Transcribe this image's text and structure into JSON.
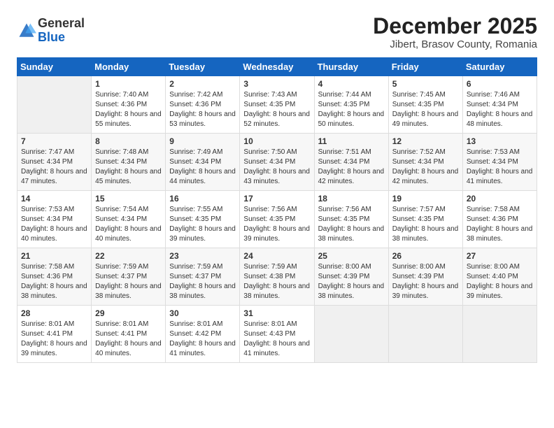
{
  "logo": {
    "general": "General",
    "blue": "Blue"
  },
  "title": "December 2025",
  "subtitle": "Jibert, Brasov County, Romania",
  "days_header": [
    "Sunday",
    "Monday",
    "Tuesday",
    "Wednesday",
    "Thursday",
    "Friday",
    "Saturday"
  ],
  "weeks": [
    [
      {
        "day": "",
        "empty": true
      },
      {
        "day": "1",
        "sunrise": "7:40 AM",
        "sunset": "4:36 PM",
        "daylight": "8 hours and 55 minutes."
      },
      {
        "day": "2",
        "sunrise": "7:42 AM",
        "sunset": "4:36 PM",
        "daylight": "8 hours and 53 minutes."
      },
      {
        "day": "3",
        "sunrise": "7:43 AM",
        "sunset": "4:35 PM",
        "daylight": "8 hours and 52 minutes."
      },
      {
        "day": "4",
        "sunrise": "7:44 AM",
        "sunset": "4:35 PM",
        "daylight": "8 hours and 50 minutes."
      },
      {
        "day": "5",
        "sunrise": "7:45 AM",
        "sunset": "4:35 PM",
        "daylight": "8 hours and 49 minutes."
      },
      {
        "day": "6",
        "sunrise": "7:46 AM",
        "sunset": "4:34 PM",
        "daylight": "8 hours and 48 minutes."
      }
    ],
    [
      {
        "day": "7",
        "sunrise": "7:47 AM",
        "sunset": "4:34 PM",
        "daylight": "8 hours and 47 minutes."
      },
      {
        "day": "8",
        "sunrise": "7:48 AM",
        "sunset": "4:34 PM",
        "daylight": "8 hours and 45 minutes."
      },
      {
        "day": "9",
        "sunrise": "7:49 AM",
        "sunset": "4:34 PM",
        "daylight": "8 hours and 44 minutes."
      },
      {
        "day": "10",
        "sunrise": "7:50 AM",
        "sunset": "4:34 PM",
        "daylight": "8 hours and 43 minutes."
      },
      {
        "day": "11",
        "sunrise": "7:51 AM",
        "sunset": "4:34 PM",
        "daylight": "8 hours and 42 minutes."
      },
      {
        "day": "12",
        "sunrise": "7:52 AM",
        "sunset": "4:34 PM",
        "daylight": "8 hours and 42 minutes."
      },
      {
        "day": "13",
        "sunrise": "7:53 AM",
        "sunset": "4:34 PM",
        "daylight": "8 hours and 41 minutes."
      }
    ],
    [
      {
        "day": "14",
        "sunrise": "7:53 AM",
        "sunset": "4:34 PM",
        "daylight": "8 hours and 40 minutes."
      },
      {
        "day": "15",
        "sunrise": "7:54 AM",
        "sunset": "4:34 PM",
        "daylight": "8 hours and 40 minutes."
      },
      {
        "day": "16",
        "sunrise": "7:55 AM",
        "sunset": "4:35 PM",
        "daylight": "8 hours and 39 minutes."
      },
      {
        "day": "17",
        "sunrise": "7:56 AM",
        "sunset": "4:35 PM",
        "daylight": "8 hours and 39 minutes."
      },
      {
        "day": "18",
        "sunrise": "7:56 AM",
        "sunset": "4:35 PM",
        "daylight": "8 hours and 38 minutes."
      },
      {
        "day": "19",
        "sunrise": "7:57 AM",
        "sunset": "4:35 PM",
        "daylight": "8 hours and 38 minutes."
      },
      {
        "day": "20",
        "sunrise": "7:58 AM",
        "sunset": "4:36 PM",
        "daylight": "8 hours and 38 minutes."
      }
    ],
    [
      {
        "day": "21",
        "sunrise": "7:58 AM",
        "sunset": "4:36 PM",
        "daylight": "8 hours and 38 minutes."
      },
      {
        "day": "22",
        "sunrise": "7:59 AM",
        "sunset": "4:37 PM",
        "daylight": "8 hours and 38 minutes."
      },
      {
        "day": "23",
        "sunrise": "7:59 AM",
        "sunset": "4:37 PM",
        "daylight": "8 hours and 38 minutes."
      },
      {
        "day": "24",
        "sunrise": "7:59 AM",
        "sunset": "4:38 PM",
        "daylight": "8 hours and 38 minutes."
      },
      {
        "day": "25",
        "sunrise": "8:00 AM",
        "sunset": "4:39 PM",
        "daylight": "8 hours and 38 minutes."
      },
      {
        "day": "26",
        "sunrise": "8:00 AM",
        "sunset": "4:39 PM",
        "daylight": "8 hours and 39 minutes."
      },
      {
        "day": "27",
        "sunrise": "8:00 AM",
        "sunset": "4:40 PM",
        "daylight": "8 hours and 39 minutes."
      }
    ],
    [
      {
        "day": "28",
        "sunrise": "8:01 AM",
        "sunset": "4:41 PM",
        "daylight": "8 hours and 39 minutes."
      },
      {
        "day": "29",
        "sunrise": "8:01 AM",
        "sunset": "4:41 PM",
        "daylight": "8 hours and 40 minutes."
      },
      {
        "day": "30",
        "sunrise": "8:01 AM",
        "sunset": "4:42 PM",
        "daylight": "8 hours and 41 minutes."
      },
      {
        "day": "31",
        "sunrise": "8:01 AM",
        "sunset": "4:43 PM",
        "daylight": "8 hours and 41 minutes."
      },
      {
        "day": "",
        "empty": true
      },
      {
        "day": "",
        "empty": true
      },
      {
        "day": "",
        "empty": true
      }
    ]
  ]
}
